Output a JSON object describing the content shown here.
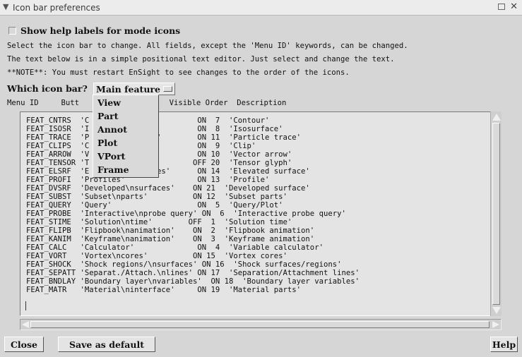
{
  "window": {
    "title": "Icon bar preferences"
  },
  "help_checkbox": {
    "label": "Show help labels for mode icons",
    "checked": false
  },
  "info": {
    "line1": "Select the icon bar to change. All fields, except the 'Menu ID' keywords, can be changed.",
    "line2": "The text below is in a simple positional text editor. Just select and change the text.",
    "line3": "**NOTE**: You must restart EnSight to see changes to the order of the icons."
  },
  "which_label": "Which icon bar?",
  "option_value": "Main feature",
  "menu_items": [
    "View",
    "Part",
    "Annot",
    "Plot",
    "VPort",
    "Frame"
  ],
  "column_header": "Menu ID     Butt                    Visible Order  Description",
  "rows": [
    "FEAT_CNTRS  'C                        ON  7  'Contour'",
    "FEAT_ISOSR  'I                        ON  8  'Isosurface'",
    "FEAT_TRACE  'P              s'        ON 11  'Particle trace'",
    "FEAT_CLIPS  'C                        ON  9  'Clip'",
    "FEAT_ARROW  'V                        ON 10  'Vector arrow'",
    "FEAT_TENSOR 'T                       OFF 20  'Tensor glyph'",
    "FEAT_ELSRF  'E              ces'      ON 14  'Elevated surface'",
    "FEAT_PROFI  'Profiles'                ON 13  'Profile'",
    "FEAT_DVSRF  'Developed\\nsurfaces'    ON 21  'Developed surface'",
    "FEAT_SUBST  'Subset\\nparts'          ON 12  'Subset parts'",
    "FEAT_QUERY  'Query'                   ON  5  'Query/Plot'",
    "FEAT_PROBE  'Interactive\\nprobe query' ON  6  'Interactive probe query'",
    "FEAT_STIME  'Solution\\ntime'        OFF  1  'Solution time'",
    "FEAT_FLIPB  'Flipbook\\nanimation'    ON  2  'Flipbook animation'",
    "FEAT_KANIM  'Keyframe\\nanimation'    ON  3  'Keyframe animation'",
    "FEAT_CALC   'Calculator'              ON  4  'Variable calculator'",
    "FEAT_VORT   'Vortex\\ncores'          ON 15  'Vortex cores'",
    "FEAT_SHOCK  'Shock regions/\\nsurfaces' ON 16  'Shock surfaces/regions'",
    "FEAT_SEPATT 'Separat./Attach.\\nlines' ON 17  'Separation/Attachment lines'",
    "FEAT_BNDLAY 'Boundary layer\\nvariables'  ON 18  'Boundary layer variables'",
    "FEAT_MATR   'Material\\ninterface'     ON 19  'Material parts'"
  ],
  "buttons": {
    "close": "Close",
    "save": "Save as default",
    "help": "Help"
  }
}
